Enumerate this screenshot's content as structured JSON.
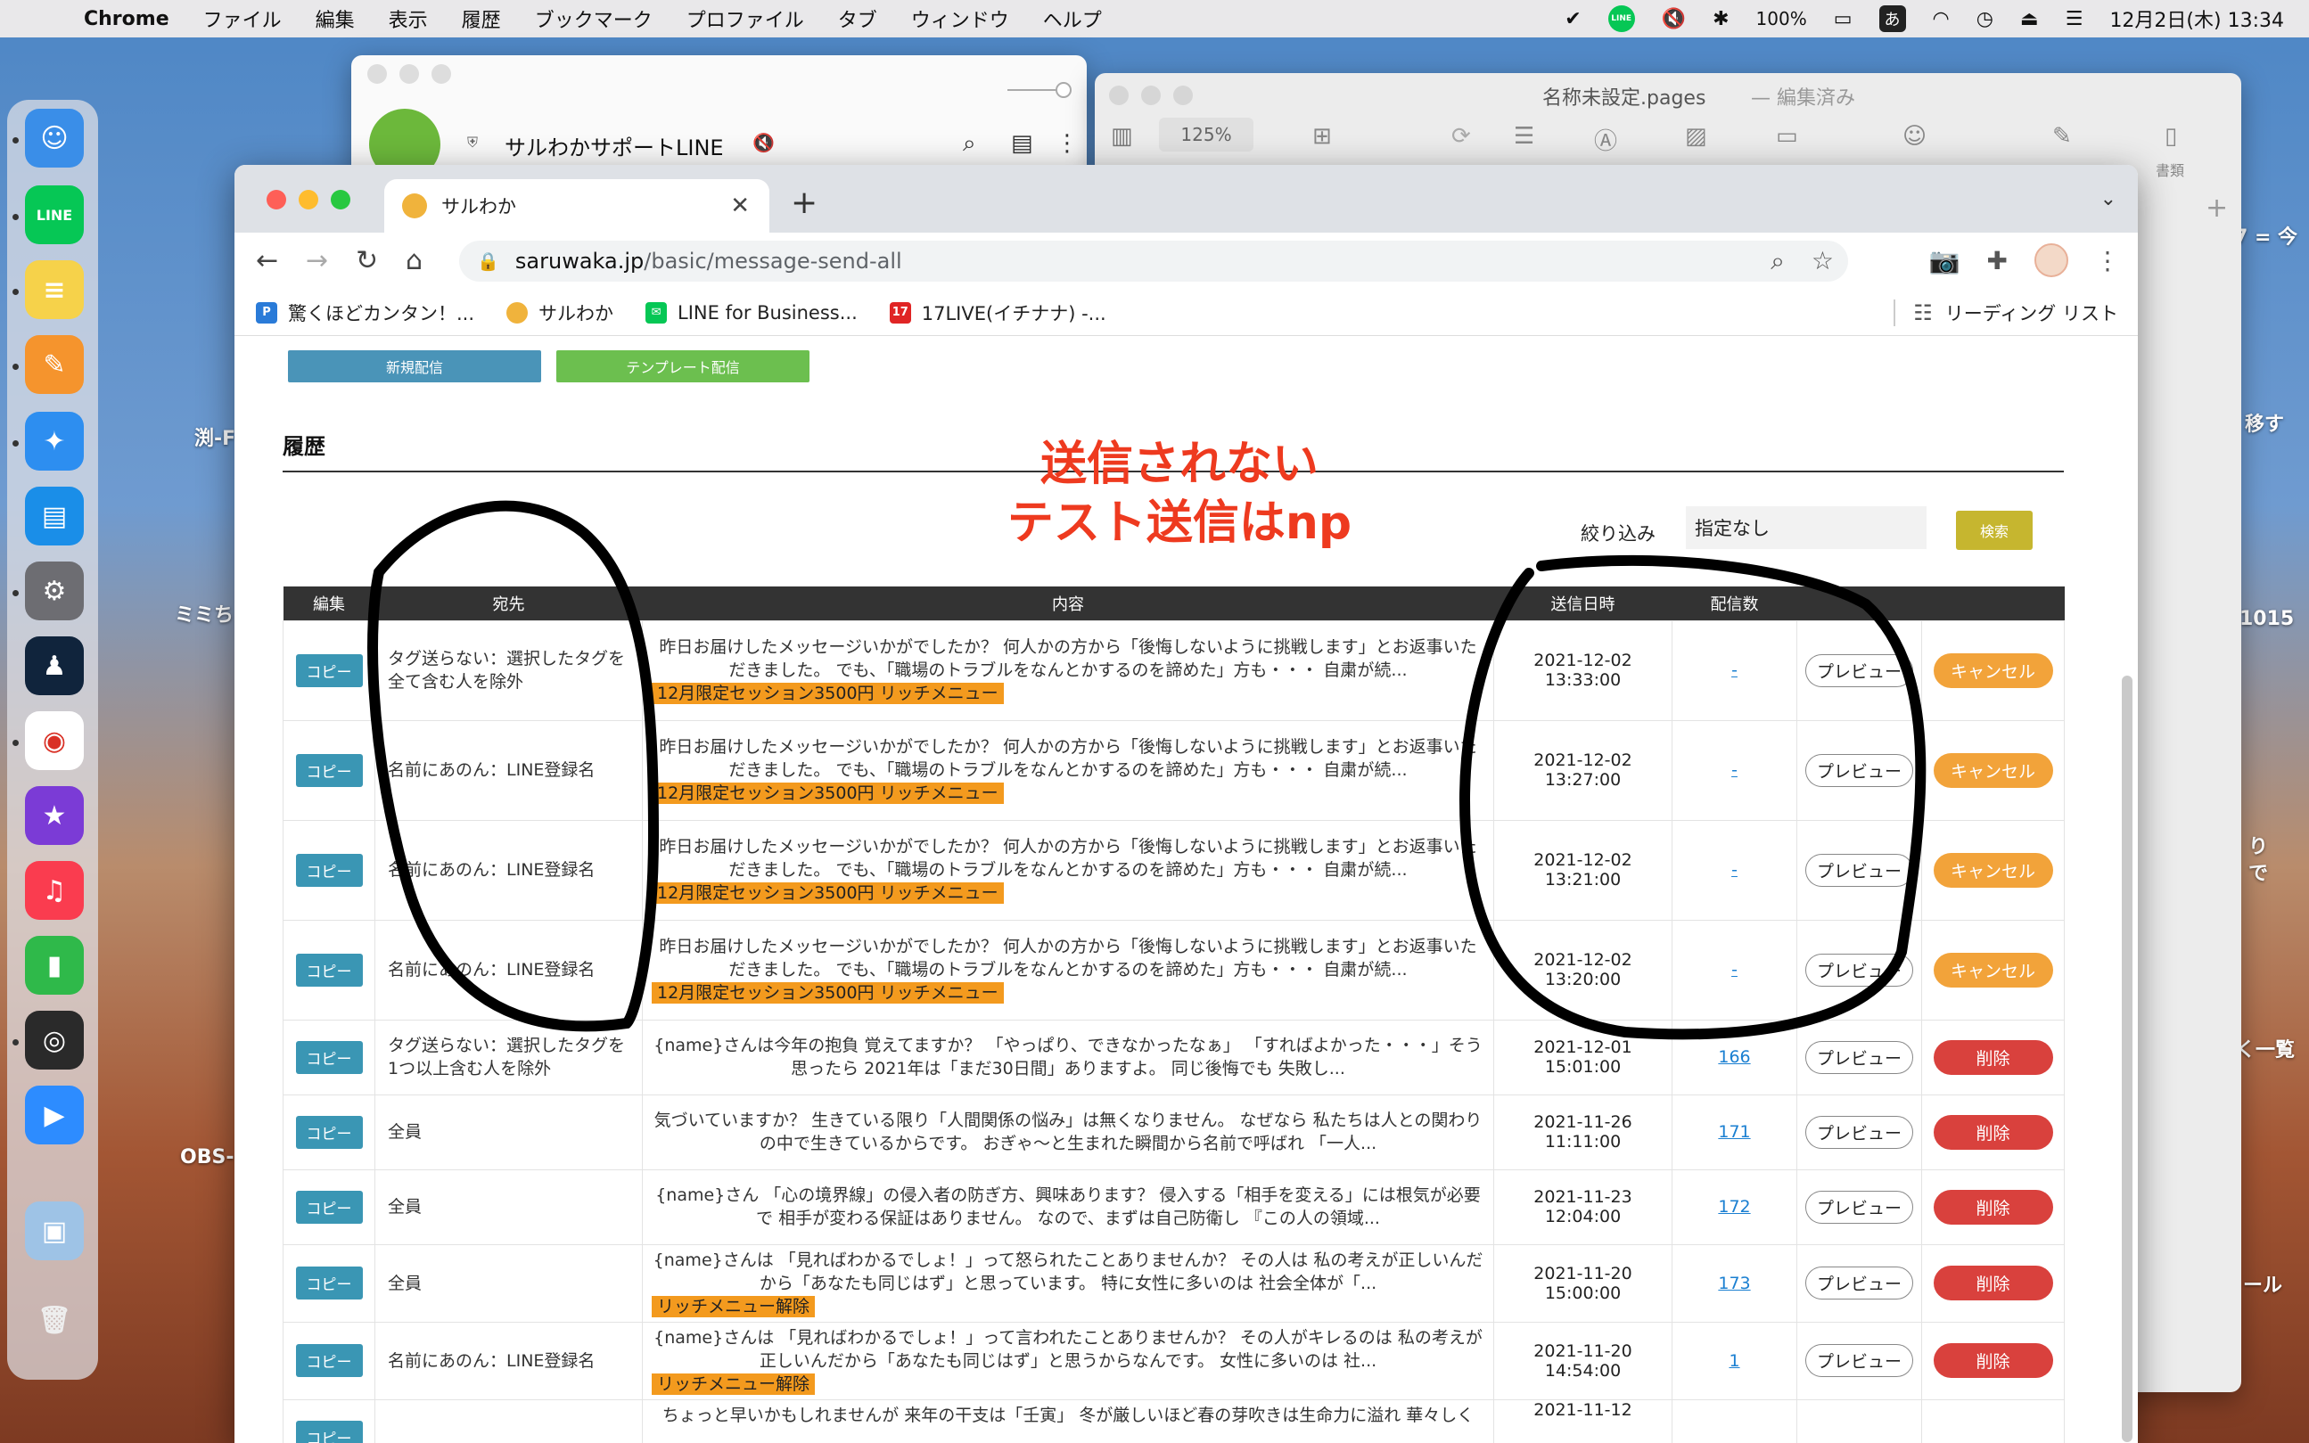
{
  "menubar": {
    "app_name": "Chrome",
    "items": [
      "ファイル",
      "編集",
      "表示",
      "履歴",
      "ブックマーク",
      "プロファイル",
      "タブ",
      "ウィンドウ",
      "ヘルプ"
    ],
    "battery": "100%",
    "ime": "あ",
    "clock": "12月2日(木) 13:34"
  },
  "desktop": {
    "labels": [
      "渕-F",
      "ミミち",
      "OBS-",
      "7 = 今",
      "移す",
      "1015",
      "り",
      "で",
      "く一覧",
      "ール"
    ]
  },
  "line_window": {
    "title": "サルわかサポートLINE"
  },
  "pages_window": {
    "title": "名称未設定.pages",
    "status": "— 編集済み",
    "zoom": "125%",
    "format_label": "書類"
  },
  "browser": {
    "tab_title": "サルわか",
    "url_host": "saruwaka.jp",
    "url_path": "/basic/message-send-all",
    "bookmarks": [
      {
        "label": "驚くほどカンタン！...",
        "color": "#2a7bd8"
      },
      {
        "label": "サルわか",
        "color": "#f0b33c"
      },
      {
        "label": "LINE for Business...",
        "color": "#06c755"
      },
      {
        "label": "17LIVE(イチナナ) -...",
        "color": "#e02525",
        "icon_text": "17"
      }
    ],
    "reading_list": "リーディング リスト"
  },
  "page": {
    "new_button": "新規配信",
    "template_button": "テンプレート配信",
    "section_title": "履歴",
    "annotation_line1": "送信されない",
    "annotation_line2": "テスト送信はnp",
    "filter_label": "絞り込み",
    "filter_value": "指定なし",
    "search_button": "検索",
    "columns": [
      "編集",
      "宛先",
      "内容",
      "送信日時",
      "配信数",
      "",
      ""
    ],
    "copy_label": "コピー",
    "preview_label": "プレビュー",
    "rows": [
      {
        "dest": "タグ送らない：選択したタグを全て含む人を除外",
        "content": "昨日お届けしたメッセージいかがでしたか？ 何人かの方から「後悔しないように挑戦します」とお返事いただきました。 でも、「職場のトラブルをなんとかするのを諦めた」方も・・・ 自粛が続...",
        "tag": "12月限定セッション3500円 リッチメニュー",
        "date": "2021-12-02",
        "time": "13:33:00",
        "count": "-",
        "action": "キャンセル",
        "action_type": "cancel"
      },
      {
        "dest": "名前にあのん：LINE登録名",
        "content": "昨日お届けしたメッセージいかがでしたか？ 何人かの方から「後悔しないように挑戦します」とお返事いただきました。 でも、「職場のトラブルをなんとかするのを諦めた」方も・・・ 自粛が続...",
        "tag": "12月限定セッション3500円 リッチメニュー",
        "date": "2021-12-02",
        "time": "13:27:00",
        "count": "-",
        "action": "キャンセル",
        "action_type": "cancel"
      },
      {
        "dest": "名前にあのん：LINE登録名",
        "content": "昨日お届けしたメッセージいかがでしたか？ 何人かの方から「後悔しないように挑戦します」とお返事いただきました。 でも、「職場のトラブルをなんとかするのを諦めた」方も・・・ 自粛が続...",
        "tag": "12月限定セッション3500円 リッチメニュー",
        "date": "2021-12-02",
        "time": "13:21:00",
        "count": "-",
        "action": "キャンセル",
        "action_type": "cancel"
      },
      {
        "dest": "名前にあのん：LINE登録名",
        "content": "昨日お届けしたメッセージいかがでしたか？ 何人かの方から「後悔しないように挑戦します」とお返事いただきました。 でも、「職場のトラブルをなんとかするのを諦めた」方も・・・ 自粛が続...",
        "tag": "12月限定セッション3500円 リッチメニュー",
        "date": "2021-12-02",
        "time": "13:20:00",
        "count": "-",
        "action": "キャンセル",
        "action_type": "cancel"
      },
      {
        "dest": "タグ送らない：選択したタグを1つ以上含む人を除外",
        "content": "{name}さんは今年の抱負 覚えてますか？ 「やっぱり、できなかったなぁ」 「すればよかった・・・」そう思ったら 2021年は「まだ30日間」ありますよ。 同じ後悔でも 失敗し...",
        "tag": "",
        "date": "2021-12-01",
        "time": "15:01:00",
        "count": "166",
        "action": "削除",
        "action_type": "delete"
      },
      {
        "dest": "全員",
        "content": "気づいていますか？ 生きている限り「人間関係の悩み」は無くなりません。 なぜなら 私たちは人との関わりの中で生きているからです。 おぎゃ〜と生まれた瞬間から名前で呼ばれ 「一人...",
        "tag": "",
        "date": "2021-11-26",
        "time": "11:11:00",
        "count": "171",
        "action": "削除",
        "action_type": "delete"
      },
      {
        "dest": "全員",
        "content": "{name}さん 「心の境界線」の侵入者の防ぎ方、興味あります？ 侵入する「相手を変える」には根気が必要で 相手が変わる保証はありません。 なので、まずは自己防衛し 『この人の領域...",
        "tag": "",
        "date": "2021-11-23",
        "time": "12:04:00",
        "count": "172",
        "action": "削除",
        "action_type": "delete"
      },
      {
        "dest": "全員",
        "content": "{name}さんは 「見ればわかるでしょ！」って怒られたことありませんか？ その人は 私の考えが正しいんだから「あなたも同じはず」と思っています。 特に女性に多いのは 社会全体が「...",
        "tag": "リッチメニュー解除",
        "date": "2021-11-20",
        "time": "15:00:00",
        "count": "173",
        "action": "削除",
        "action_type": "delete"
      },
      {
        "dest": "名前にあのん：LINE登録名",
        "content": "{name}さんは 「見ればわかるでしょ！」って言われたことありませんか？ その人がキレるのは 私の考えが正しいんだから「あなたも同じはず」と思うからなんです。 女性に多いのは 社...",
        "tag": "リッチメニュー解除",
        "date": "2021-11-20",
        "time": "14:54:00",
        "count": "1",
        "action": "削除",
        "action_type": "delete"
      },
      {
        "dest": "",
        "content": "ちょっと早いかもしれませんが 来年の干支は「壬寅」 冬が厳しいほど春の芽吹きは生命力に溢れ 華々しく",
        "tag": "",
        "date": "2021-11-12",
        "time": "",
        "count": "",
        "action": "",
        "action_type": "delete"
      }
    ]
  },
  "colors": {
    "annotation": "#ee3a1f",
    "copy_button": "#3a96b4",
    "cancel_button": "#f2a33a",
    "delete_button": "#d9413d",
    "new_button": "#4a94b8",
    "template_button": "#6cbf4f",
    "search_button": "#c6b62f",
    "tag_highlight": "#f39a1e"
  }
}
